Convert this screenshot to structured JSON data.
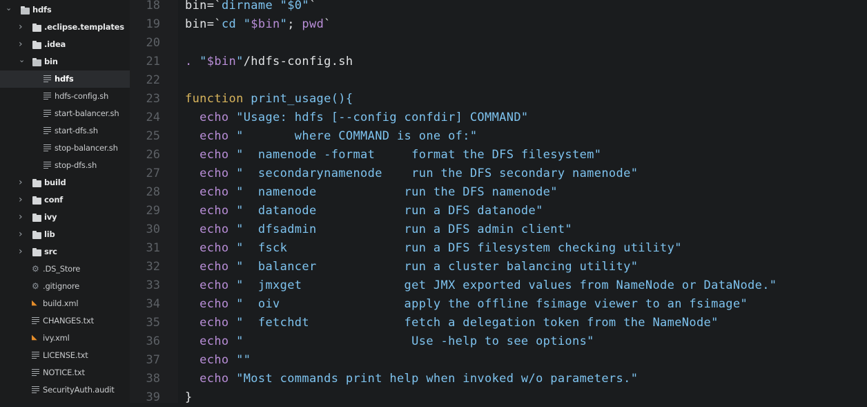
{
  "sidebar": {
    "items": [
      {
        "label": "hdfs",
        "kind": "folder",
        "depth": 0,
        "expanded": true,
        "icon": "folder-open-icon"
      },
      {
        "label": ".eclipse.templates",
        "kind": "folder",
        "depth": 1,
        "expanded": false,
        "icon": "folder-icon"
      },
      {
        "label": ".idea",
        "kind": "folder",
        "depth": 1,
        "expanded": false,
        "icon": "folder-icon"
      },
      {
        "label": "bin",
        "kind": "folder",
        "depth": 1,
        "expanded": true,
        "icon": "folder-open-icon"
      },
      {
        "label": "hdfs",
        "kind": "file",
        "depth": 2,
        "icon": "text-file-icon",
        "selected": true
      },
      {
        "label": "hdfs-config.sh",
        "kind": "file",
        "depth": 2,
        "icon": "text-file-icon"
      },
      {
        "label": "start-balancer.sh",
        "kind": "file",
        "depth": 2,
        "icon": "text-file-icon"
      },
      {
        "label": "start-dfs.sh",
        "kind": "file",
        "depth": 2,
        "icon": "text-file-icon"
      },
      {
        "label": "stop-balancer.sh",
        "kind": "file",
        "depth": 2,
        "icon": "text-file-icon"
      },
      {
        "label": "stop-dfs.sh",
        "kind": "file",
        "depth": 2,
        "icon": "text-file-icon"
      },
      {
        "label": "build",
        "kind": "folder",
        "depth": 1,
        "expanded": false,
        "icon": "folder-icon"
      },
      {
        "label": "conf",
        "kind": "folder",
        "depth": 1,
        "expanded": false,
        "icon": "folder-icon"
      },
      {
        "label": "ivy",
        "kind": "folder",
        "depth": 1,
        "expanded": false,
        "icon": "folder-icon"
      },
      {
        "label": "lib",
        "kind": "folder",
        "depth": 1,
        "expanded": false,
        "icon": "folder-icon"
      },
      {
        "label": "src",
        "kind": "folder",
        "depth": 1,
        "expanded": false,
        "icon": "folder-icon"
      },
      {
        "label": ".DS_Store",
        "kind": "file",
        "depth": 1,
        "icon": "gear-icon"
      },
      {
        "label": ".gitignore",
        "kind": "file",
        "depth": 1,
        "icon": "gear-icon"
      },
      {
        "label": "build.xml",
        "kind": "file",
        "depth": 1,
        "icon": "rss-icon"
      },
      {
        "label": "CHANGES.txt",
        "kind": "file",
        "depth": 1,
        "icon": "text-file-icon"
      },
      {
        "label": "ivy.xml",
        "kind": "file",
        "depth": 1,
        "icon": "rss-icon"
      },
      {
        "label": "LICENSE.txt",
        "kind": "file",
        "depth": 1,
        "icon": "text-file-icon"
      },
      {
        "label": "NOTICE.txt",
        "kind": "file",
        "depth": 1,
        "icon": "text-file-icon"
      },
      {
        "label": "SecurityAuth.audit",
        "kind": "file",
        "depth": 1,
        "icon": "text-file-icon"
      }
    ]
  },
  "editor": {
    "lines": [
      {
        "n": "18",
        "tokens": [
          [
            "plain",
            "bin=`"
          ],
          [
            "cmd",
            "dirname "
          ],
          [
            "str",
            "\"$0\""
          ],
          [
            "plain",
            "`"
          ]
        ]
      },
      {
        "n": "19",
        "tokens": [
          [
            "plain",
            "bin=`"
          ],
          [
            "cmd",
            "cd "
          ],
          [
            "str",
            "\""
          ],
          [
            "var",
            "$bin"
          ],
          [
            "str",
            "\""
          ],
          [
            "plain",
            "; "
          ],
          [
            "var",
            "pwd"
          ],
          [
            "plain",
            "`"
          ]
        ]
      },
      {
        "n": "20",
        "tokens": []
      },
      {
        "n": "21",
        "tokens": [
          [
            "dot",
            ". "
          ],
          [
            "str",
            "\""
          ],
          [
            "var",
            "$bin"
          ],
          [
            "str",
            "\""
          ],
          [
            "plain",
            "/hdfs-config.sh"
          ]
        ]
      },
      {
        "n": "22",
        "tokens": []
      },
      {
        "n": "23",
        "tokens": [
          [
            "kw",
            "function "
          ],
          [
            "fn",
            "print_usage(){"
          ]
        ]
      },
      {
        "n": "24",
        "tokens": [
          [
            "plain",
            "  "
          ],
          [
            "echo",
            "echo "
          ],
          [
            "str",
            "\"Usage: hdfs [--config confdir] COMMAND\""
          ]
        ]
      },
      {
        "n": "25",
        "tokens": [
          [
            "plain",
            "  "
          ],
          [
            "echo",
            "echo "
          ],
          [
            "str",
            "\"       where COMMAND is one of:\""
          ]
        ]
      },
      {
        "n": "26",
        "tokens": [
          [
            "plain",
            "  "
          ],
          [
            "echo",
            "echo "
          ],
          [
            "str",
            "\"  namenode -format     format the DFS filesystem\""
          ]
        ]
      },
      {
        "n": "27",
        "tokens": [
          [
            "plain",
            "  "
          ],
          [
            "echo",
            "echo "
          ],
          [
            "str",
            "\"  secondarynamenode    run the DFS secondary namenode\""
          ]
        ]
      },
      {
        "n": "28",
        "tokens": [
          [
            "plain",
            "  "
          ],
          [
            "echo",
            "echo "
          ],
          [
            "str",
            "\"  namenode            run the DFS namenode\""
          ]
        ]
      },
      {
        "n": "29",
        "tokens": [
          [
            "plain",
            "  "
          ],
          [
            "echo",
            "echo "
          ],
          [
            "str",
            "\"  datanode            run a DFS datanode\""
          ]
        ]
      },
      {
        "n": "30",
        "tokens": [
          [
            "plain",
            "  "
          ],
          [
            "echo",
            "echo "
          ],
          [
            "str",
            "\"  dfsadmin            run a DFS admin client\""
          ]
        ]
      },
      {
        "n": "31",
        "tokens": [
          [
            "plain",
            "  "
          ],
          [
            "echo",
            "echo "
          ],
          [
            "str",
            "\"  fsck                run a DFS filesystem checking utility\""
          ]
        ]
      },
      {
        "n": "32",
        "tokens": [
          [
            "plain",
            "  "
          ],
          [
            "echo",
            "echo "
          ],
          [
            "str",
            "\"  balancer            run a cluster balancing utility\""
          ]
        ]
      },
      {
        "n": "33",
        "tokens": [
          [
            "plain",
            "  "
          ],
          [
            "echo",
            "echo "
          ],
          [
            "str",
            "\"  jmxget              get JMX exported values from NameNode or DataNode.\""
          ]
        ]
      },
      {
        "n": "34",
        "tokens": [
          [
            "plain",
            "  "
          ],
          [
            "echo",
            "echo "
          ],
          [
            "str",
            "\"  oiv                 apply the offline fsimage viewer to an fsimage\""
          ]
        ]
      },
      {
        "n": "35",
        "tokens": [
          [
            "plain",
            "  "
          ],
          [
            "echo",
            "echo "
          ],
          [
            "str",
            "\"  fetchdt             fetch a delegation token from the NameNode\""
          ]
        ]
      },
      {
        "n": "36",
        "tokens": [
          [
            "plain",
            "  "
          ],
          [
            "echo",
            "echo "
          ],
          [
            "str",
            "\"                       Use -help to see options\""
          ]
        ]
      },
      {
        "n": "37",
        "tokens": [
          [
            "plain",
            "  "
          ],
          [
            "echo",
            "echo "
          ],
          [
            "str",
            "\"\""
          ]
        ]
      },
      {
        "n": "38",
        "tokens": [
          [
            "plain",
            "  "
          ],
          [
            "echo",
            "echo "
          ],
          [
            "str",
            "\"Most commands print help when invoked w/o parameters.\""
          ]
        ]
      },
      {
        "n": "39",
        "tokens": [
          [
            "plain",
            "}"
          ]
        ]
      }
    ]
  }
}
